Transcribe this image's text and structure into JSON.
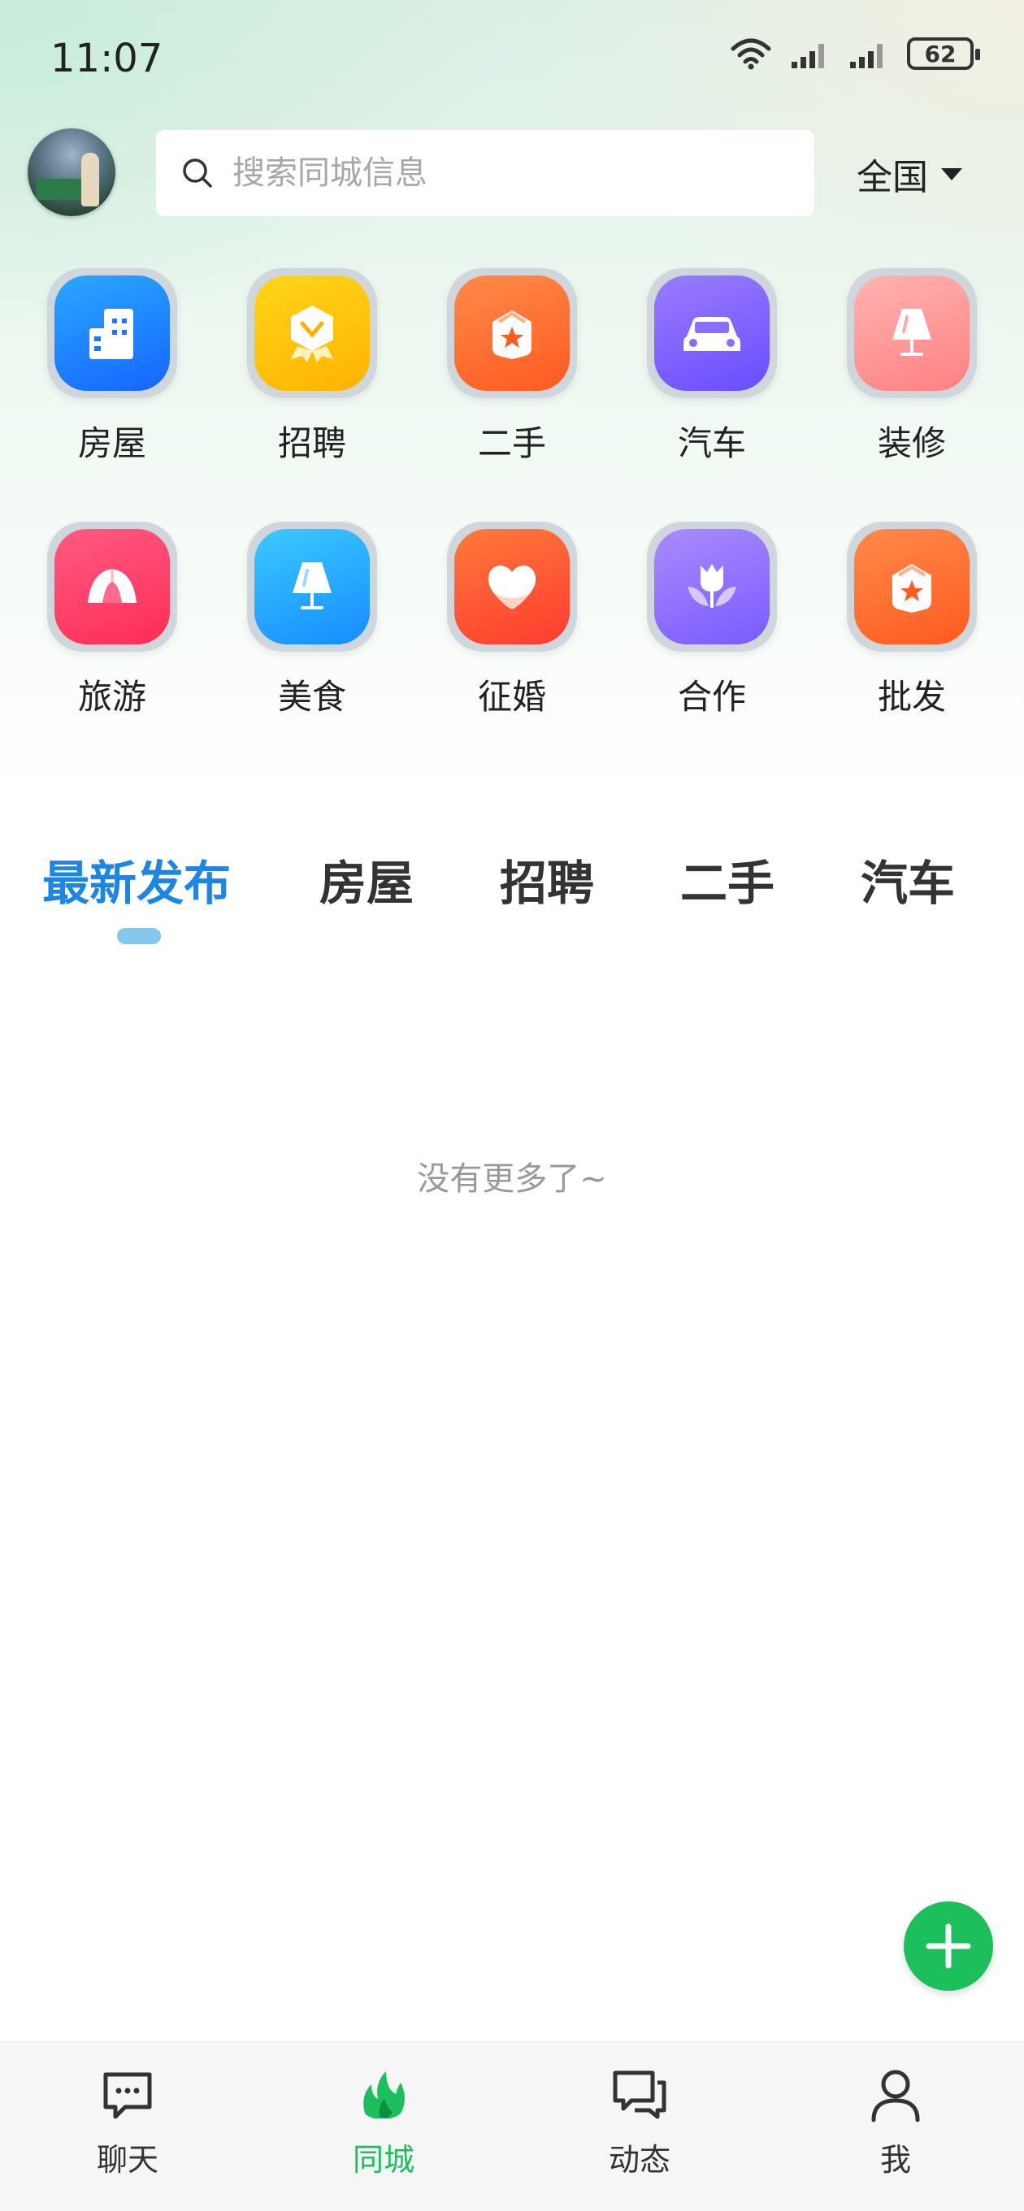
{
  "status_bar": {
    "time": "11:07",
    "battery": "62"
  },
  "header": {
    "search_placeholder": "搜索同城信息",
    "region": "全国"
  },
  "categories": [
    {
      "label": "房屋",
      "icon": "building-icon",
      "color_from": "#2aa8ff",
      "color_to": "#1565ff"
    },
    {
      "label": "招聘",
      "icon": "badge-icon",
      "color_from": "#ffd51a",
      "color_to": "#ffb300"
    },
    {
      "label": "二手",
      "icon": "star-box-icon",
      "color_from": "#ff8a4a",
      "color_to": "#ff5a1f"
    },
    {
      "label": "汽车",
      "icon": "car-icon",
      "color_from": "#9a7bff",
      "color_to": "#6a4dff"
    },
    {
      "label": "装修",
      "icon": "lamp-icon",
      "color_from": "#ffb3b3",
      "color_to": "#ff8080"
    },
    {
      "label": "旅游",
      "icon": "tent-icon",
      "color_from": "#ff5a82",
      "color_to": "#ff2d55"
    },
    {
      "label": "美食",
      "icon": "lamp-icon",
      "color_from": "#3cc8ff",
      "color_to": "#168cff"
    },
    {
      "label": "征婚",
      "icon": "heart-icon",
      "color_from": "#ff7a3a",
      "color_to": "#ff3b2f"
    },
    {
      "label": "合作",
      "icon": "tulip-icon",
      "color_from": "#a98bff",
      "color_to": "#7a5bff"
    },
    {
      "label": "批发",
      "icon": "star-box-icon",
      "color_from": "#ff8a4a",
      "color_to": "#ff5a1f"
    }
  ],
  "tabs": [
    "最新发布",
    "房屋",
    "招聘",
    "二手",
    "汽车"
  ],
  "active_tab": "最新发布",
  "empty_message": "没有更多了~",
  "bottom_nav": [
    {
      "label": "聊天",
      "icon": "chat-icon"
    },
    {
      "label": "同城",
      "icon": "flame-icon",
      "active": true
    },
    {
      "label": "动态",
      "icon": "comments-icon"
    },
    {
      "label": "我",
      "icon": "user-icon"
    }
  ],
  "colors": {
    "accent_blue": "#1b86e6",
    "accent_green": "#1bbf5c"
  }
}
